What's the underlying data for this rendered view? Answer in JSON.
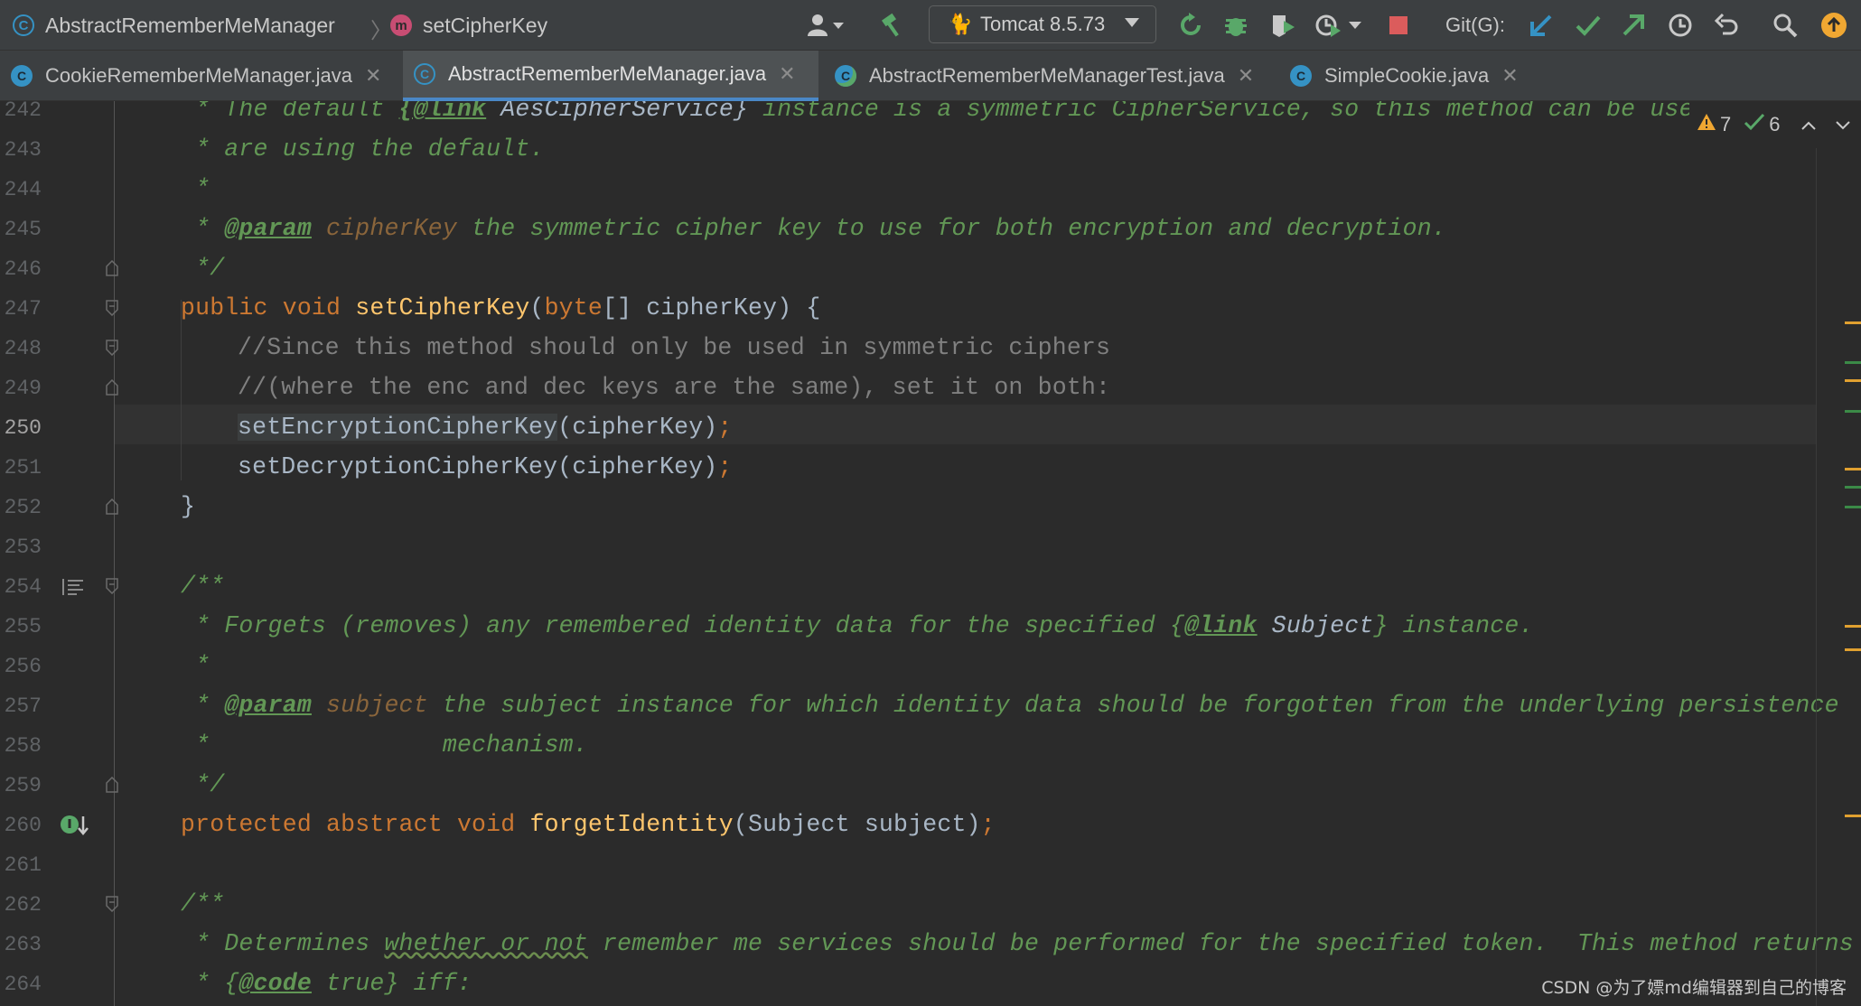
{
  "navbar": {
    "breadcrumb_class": "AbstractRememberMeManager",
    "breadcrumb_method": "setCipherKey",
    "run_config": "Tomcat 8.5.73",
    "git_label": "Git(G):",
    "icons": [
      "user-icon",
      "hammer-icon",
      "tomcat-icon",
      "rerun-icon",
      "debug-icon",
      "coverage-icon",
      "profile-icon",
      "stop-icon",
      "git-update-icon",
      "git-commit-icon",
      "git-push-icon",
      "history-icon",
      "rollback-icon",
      "search-icon",
      "update-available-icon"
    ]
  },
  "tabs": [
    {
      "label": "CookieRememberMeManager.java",
      "active": false
    },
    {
      "label": "AbstractRememberMeManager.java",
      "active": true
    },
    {
      "label": "AbstractRememberMeManagerTest.java",
      "active": false
    },
    {
      "label": "SimpleCookie.java",
      "active": false
    }
  ],
  "inspection": {
    "warnings": "7",
    "ok": "6"
  },
  "editor": {
    "current_line": "250",
    "lines": [
      {
        "n": "242"
      },
      {
        "n": "243"
      },
      {
        "n": "244"
      },
      {
        "n": "245"
      },
      {
        "n": "246"
      },
      {
        "n": "247"
      },
      {
        "n": "248"
      },
      {
        "n": "249"
      },
      {
        "n": "250"
      },
      {
        "n": "251"
      },
      {
        "n": "252"
      },
      {
        "n": "253"
      },
      {
        "n": "254"
      },
      {
        "n": "255"
      },
      {
        "n": "256"
      },
      {
        "n": "257"
      },
      {
        "n": "258"
      },
      {
        "n": "259"
      },
      {
        "n": "260"
      },
      {
        "n": "261"
      },
      {
        "n": "262"
      },
      {
        "n": "263"
      },
      {
        "n": "264"
      }
    ],
    "code": {
      "l242": [
        " * The default ",
        "{@link",
        " AesCipherService}",
        " instance is a symmetric CipherService, so this method can be used if you"
      ],
      "l243": " * are using the default.",
      "l244": " *",
      "l245": [
        " * ",
        "@param",
        " cipherKey",
        " the symmetric cipher key to use for both encryption and decryption."
      ],
      "l246": " */",
      "l247": [
        "public void ",
        "setCipherKey",
        "(",
        "byte",
        "[] cipherKey) {"
      ],
      "l248": "//Since this method should only be used in symmetric ciphers",
      "l249": "//(where the enc and dec keys are the same), set it on both:",
      "l250": [
        "setEncryptionCipherKey",
        "(cipherKey)",
        ";"
      ],
      "l251": [
        "setDecryptionCipherKey",
        "(cipherKey)",
        ";"
      ],
      "l252": "}",
      "l254": "/**",
      "l255": [
        " * Forgets (removes) any remembered identity data for the specified ",
        "{",
        "@link",
        " Subject",
        "}",
        " instance."
      ],
      "l256": " *",
      "l257": [
        " * ",
        "@param",
        " subject",
        " the subject instance for which identity data should be forgotten from the underlying persistence"
      ],
      "l258": " *                mechanism.",
      "l259": " */",
      "l260": [
        "protected abstract void ",
        "forgetIdentity",
        "(Subject subject)",
        ";"
      ],
      "l262": "/**",
      "l263": [
        " * Determines ",
        "whether or not",
        " remember me services should be performed for the specified token.  This method returns"
      ],
      "l264": [
        " * ",
        "{",
        "@code",
        " true}",
        " iff:"
      ]
    }
  },
  "watermark": "CSDN @为了嫖md编辑器到自己的博客"
}
